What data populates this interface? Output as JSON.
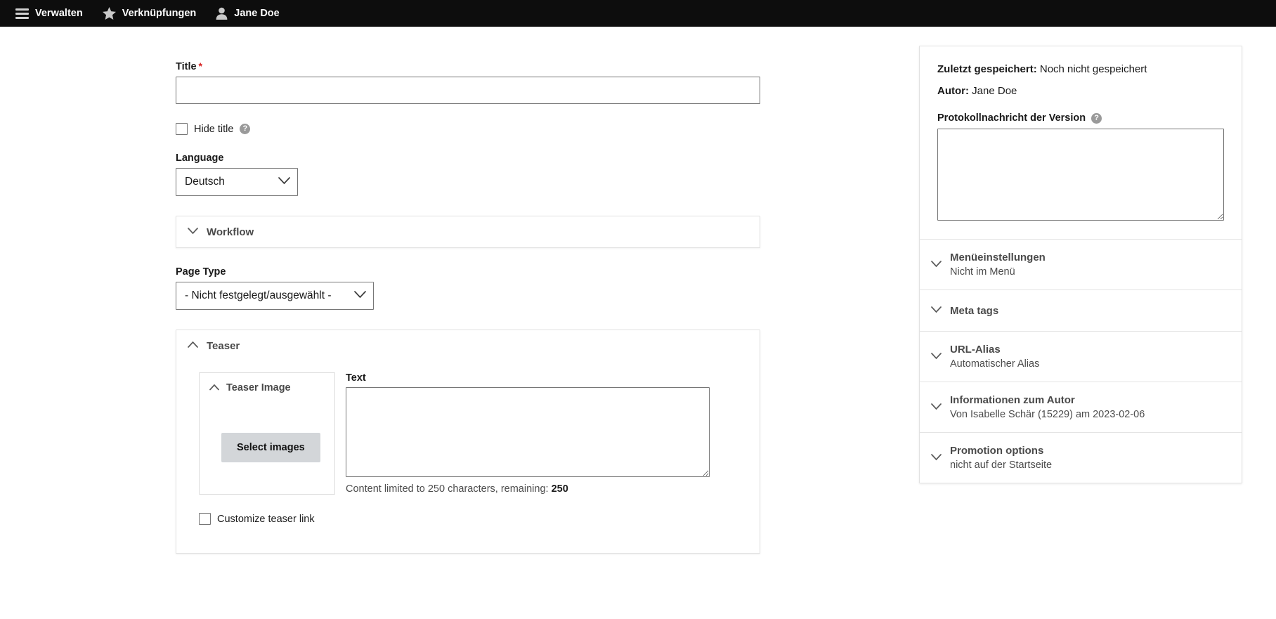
{
  "toolbar": {
    "items": [
      {
        "icon": "hamburger-icon",
        "label": "Verwalten"
      },
      {
        "icon": "star-icon",
        "label": "Verknüpfungen"
      },
      {
        "icon": "user-icon",
        "label": "Jane Doe"
      }
    ]
  },
  "main": {
    "title_label": "Title",
    "title_required_mark": "*",
    "title_value": "",
    "hide_title_label": "Hide title",
    "hide_title_help": "?",
    "language_label": "Language",
    "language_value": "Deutsch",
    "workflow_label": "Workflow",
    "page_type_label": "Page Type",
    "page_type_value": "- Nicht festgelegt/ausgewählt -",
    "teaser_label": "Teaser",
    "teaser_image_label": "Teaser Image",
    "select_images_label": "Select images",
    "text_label": "Text",
    "text_value": "",
    "char_limit_prefix": "Content limited to 250 characters, remaining: ",
    "char_limit_remaining": "250",
    "customize_teaser_link_label": "Customize teaser link"
  },
  "sidebar": {
    "last_saved_label": "Zuletzt gespeichert:",
    "last_saved_value": "Noch nicht gespeichert",
    "author_label": "Autor:",
    "author_value": "Jane Doe",
    "revision_log_label": "Protokollnachricht der Version",
    "revision_log_help": "?",
    "revision_log_value": "",
    "sections": [
      {
        "title": "Menüeinstellungen",
        "summary": "Nicht im Menü"
      },
      {
        "title": "Meta tags",
        "summary": ""
      },
      {
        "title": "URL-Alias",
        "summary": "Automatischer Alias"
      },
      {
        "title": "Informationen zum Autor",
        "summary": "Von Isabelle Schär (15229) am 2023-02-06"
      },
      {
        "title": "Promotion options",
        "summary": "nicht auf der Startseite"
      }
    ]
  },
  "colors": {
    "toolbar_bg": "#0d0d0d",
    "required_red": "#d72222",
    "button_grey": "#d3d6d9",
    "panel_border": "#e2e2e2"
  }
}
